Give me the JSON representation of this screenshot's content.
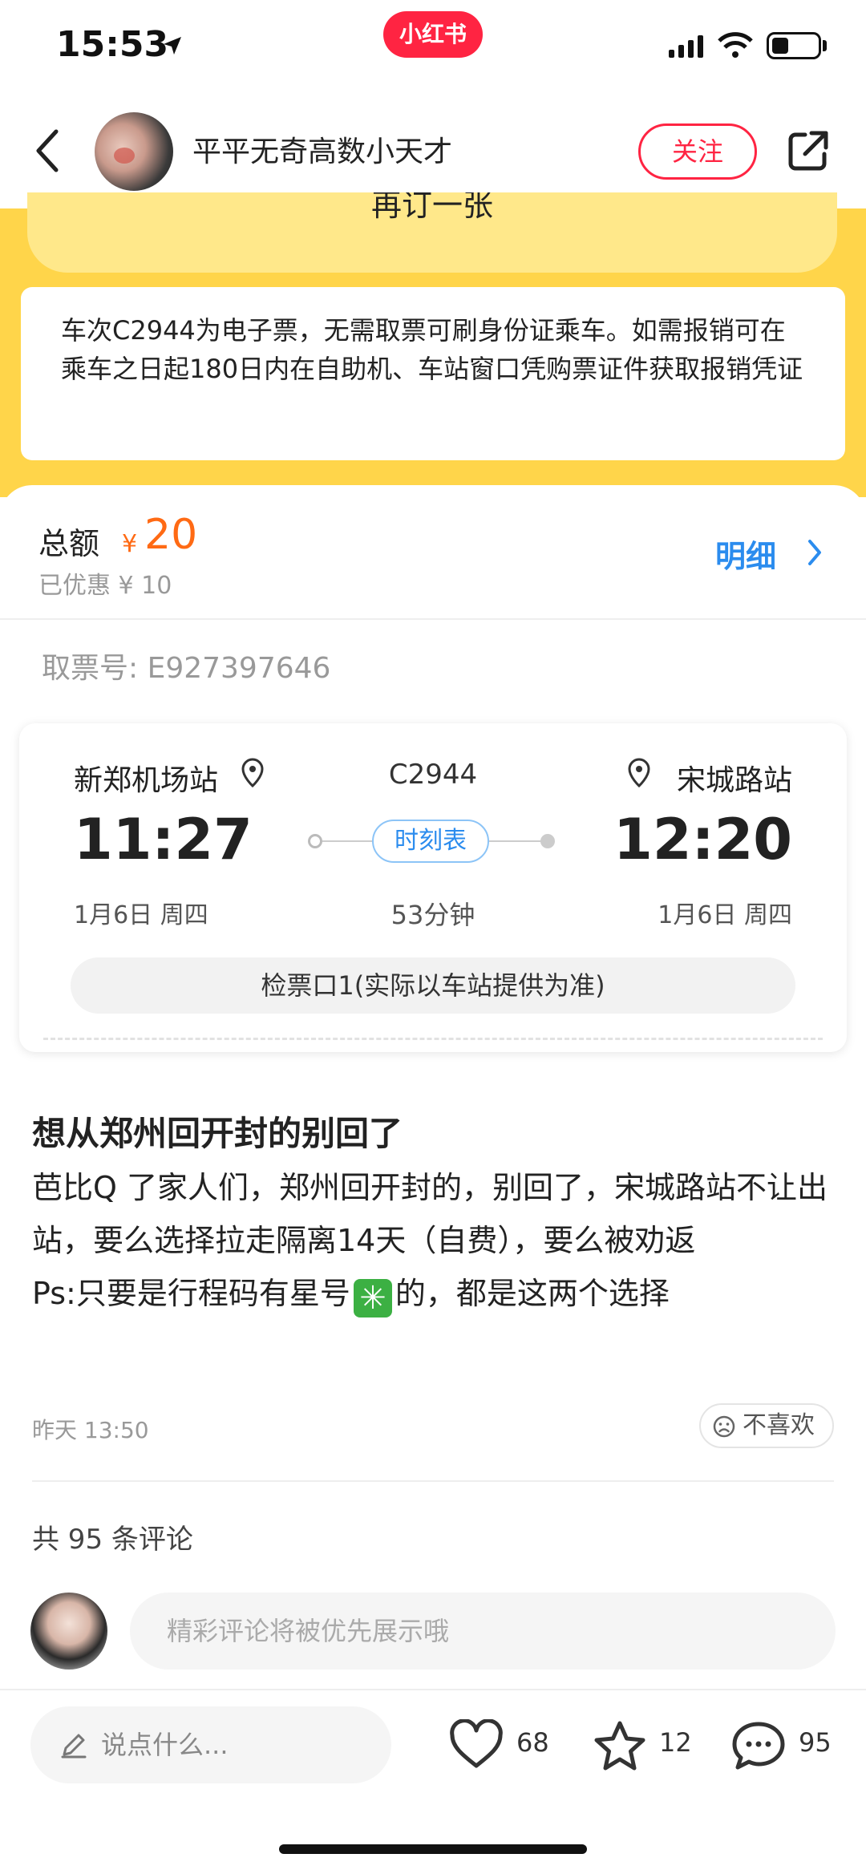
{
  "status_bar": {
    "time": "15:53",
    "app_badge": "小红书"
  },
  "header": {
    "author_name": "平平无奇高数小天才",
    "follow_label": "关注"
  },
  "ticket_screenshot": {
    "rebook_label": "再订一张",
    "notice": "车次C2944为电子票，无需取票可刷身份证乘车。如需报销可在乘车之日起180日内在自助机、车站窗口凭购票证件获取报销凭证",
    "total_label": "总额",
    "currency": "¥",
    "total_amount": "20",
    "discount": "已优惠 ¥ 10",
    "detail_label": "明细",
    "pickup_number": "取票号: E927397646",
    "from_station": "新郑机场站",
    "to_station": "宋城路站",
    "train_number": "C2944",
    "depart_time": "11:27",
    "arrive_time": "12:20",
    "schedule_label": "时刻表",
    "depart_date": "1月6日 周四",
    "arrive_date": "1月6日 周四",
    "duration": "53分钟",
    "gate": "检票口1(实际以车站提供为准)"
  },
  "post": {
    "title": "想从郑州回开封的别回了",
    "body_line1": "芭比Q 了家人们，郑州回开封的，别回了，宋城路站不让出站，要么选择拉走隔离14天（自费），要么被劝返",
    "body_line2_prefix": "Ps:只要是行程码有星号",
    "body_line2_emoji": "✳",
    "body_line2_suffix": "的，都是这两个选择",
    "date": "昨天 13:50",
    "dislike_label": "不喜欢"
  },
  "comments": {
    "count_label": "共 95 条评论",
    "input_placeholder": "精彩评论将被优先展示哦"
  },
  "bottom_bar": {
    "say_placeholder": "说点什么...",
    "likes": "68",
    "favorites": "12",
    "comments": "95"
  },
  "colors": {
    "brand_red": "#ff2442",
    "ticket_yellow": "#ffd54a",
    "price_orange": "#ff6a14",
    "link_blue": "#2b8cee"
  }
}
